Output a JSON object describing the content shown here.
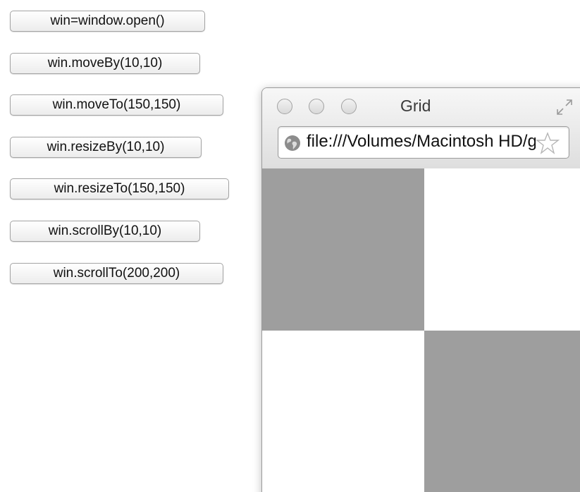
{
  "buttons": {
    "open": "win=window.open()",
    "move_by": "win.moveBy(10,10)",
    "move_to": "win.moveTo(150,150)",
    "resize_by": "win.resizeBy(10,10)",
    "resize_to": "win.resizeTo(150,150)",
    "scroll_by": "win.scrollBy(10,10)",
    "scroll_to": "win.scrollTo(200,200)"
  },
  "popup": {
    "title": "Grid",
    "url": "file:///Volumes/Macintosh HD/grid.html",
    "icons": {
      "traffic_lights": "window-control-icon",
      "fullscreen": "fullscreen-icon",
      "site": "globe-icon",
      "bookmark": "star-icon"
    },
    "grid": {
      "cells": [
        {
          "position": "top-left",
          "color": "#9e9e9e"
        },
        {
          "position": "top-right",
          "color": "#ffffff"
        },
        {
          "position": "bottom-left",
          "color": "#ffffff"
        },
        {
          "position": "bottom-right",
          "color": "#9e9e9e"
        }
      ]
    }
  }
}
